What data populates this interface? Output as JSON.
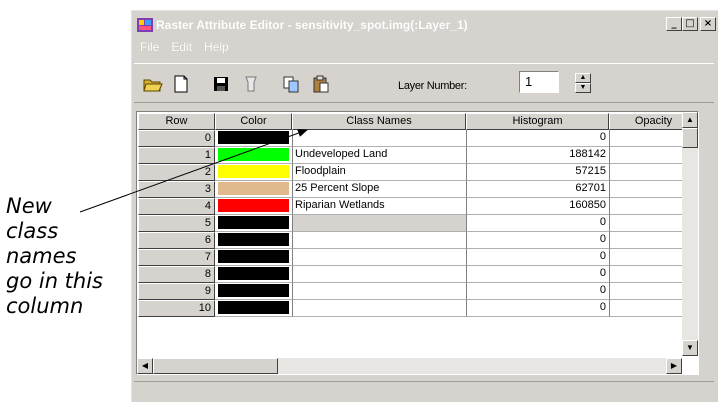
{
  "callout": {
    "lines": [
      "New",
      "class",
      "names",
      "go in this",
      "column"
    ]
  },
  "window": {
    "title": "Raster Attribute Editor - sensitivity_spot.img(:Layer_1)",
    "controls": {
      "minimize": "_",
      "maximize": "□",
      "close": "×"
    }
  },
  "menu": {
    "items": [
      "File",
      "Edit",
      "Help"
    ]
  },
  "toolbar": {
    "icons": [
      "open-folder-icon",
      "new-document-icon",
      "save-disk-icon",
      "column-properties-icon",
      "copy-icon",
      "paste-icon"
    ],
    "layer_label": "Layer Number:",
    "layer_value": "1"
  },
  "table": {
    "headers": {
      "row": "Row",
      "color": "Color",
      "class_names": "Class Names",
      "histogram": "Histogram",
      "opacity": "Opacity"
    },
    "rows": [
      {
        "row": "0",
        "color": "#000000",
        "name": "",
        "histogram": "0"
      },
      {
        "row": "1",
        "color": "#00ff00",
        "name": "Undeveloped Land",
        "histogram": "188142"
      },
      {
        "row": "2",
        "color": "#ffff00",
        "name": "Floodplain",
        "histogram": "57215"
      },
      {
        "row": "3",
        "color": "#e2b98c",
        "name": "25 Percent Slope",
        "histogram": "62701"
      },
      {
        "row": "4",
        "color": "#ff0000",
        "name": "Riparian Wetlands",
        "histogram": "160850"
      },
      {
        "row": "5",
        "color": "#000000",
        "name": "",
        "histogram": "0"
      },
      {
        "row": "6",
        "color": "#000000",
        "name": "",
        "histogram": "0"
      },
      {
        "row": "7",
        "color": "#000000",
        "name": "",
        "histogram": "0"
      },
      {
        "row": "8",
        "color": "#000000",
        "name": "",
        "histogram": "0"
      },
      {
        "row": "9",
        "color": "#000000",
        "name": "",
        "histogram": "0"
      },
      {
        "row": "10",
        "color": "#000000",
        "name": "",
        "histogram": "0"
      }
    ],
    "selected_row": "5"
  },
  "colors": {
    "window_bg": "#d6d3ce",
    "title_text": "#ffffff"
  }
}
